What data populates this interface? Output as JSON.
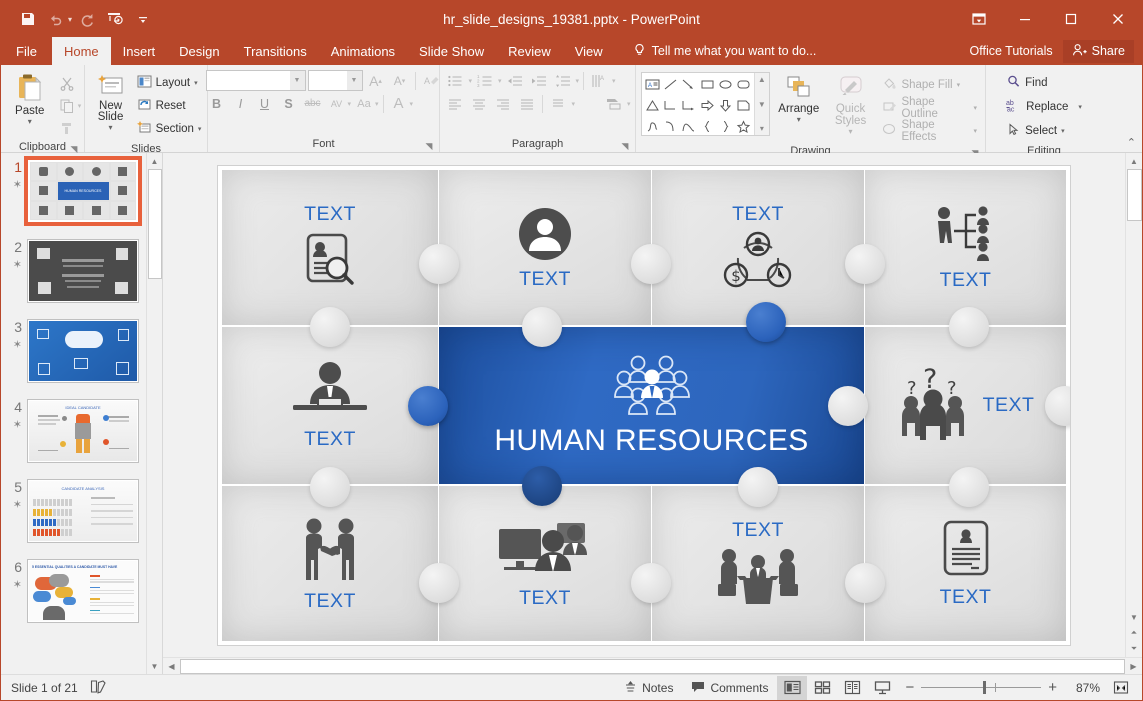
{
  "window": {
    "title": "hr_slide_designs_19381.pptx - PowerPoint",
    "quick_access": [
      {
        "name": "save-icon",
        "label": "Save"
      },
      {
        "name": "undo-icon",
        "label": "Undo"
      },
      {
        "name": "redo-icon",
        "label": "Redo"
      },
      {
        "name": "start-slideshow-icon",
        "label": "Start From Beginning"
      },
      {
        "name": "customize-qat-icon",
        "label": "Customize Quick Access Toolbar"
      }
    ],
    "controls": [
      {
        "name": "ribbon-display-options-icon",
        "label": "Ribbon Display Options"
      },
      {
        "name": "minimize-icon",
        "label": "Minimize"
      },
      {
        "name": "restore-icon",
        "label": "Restore Down"
      },
      {
        "name": "close-icon",
        "label": "Close"
      }
    ],
    "accent_color": "#b7472a"
  },
  "tabs": [
    {
      "label": "File",
      "active": false
    },
    {
      "label": "Home",
      "active": true
    },
    {
      "label": "Insert",
      "active": false
    },
    {
      "label": "Design",
      "active": false
    },
    {
      "label": "Transitions",
      "active": false
    },
    {
      "label": "Animations",
      "active": false
    },
    {
      "label": "Slide Show",
      "active": false
    },
    {
      "label": "Review",
      "active": false
    },
    {
      "label": "View",
      "active": false
    }
  ],
  "tellme": {
    "placeholder": "Tell me what you want to do...",
    "icon": "lightbulb-icon"
  },
  "account": {
    "name": "Office Tutorials",
    "share_label": "Share",
    "share_icon": "person-add-icon"
  },
  "ribbon": {
    "groups": [
      {
        "label": "Clipboard",
        "items": [
          {
            "label": "Paste",
            "name": "paste-button",
            "icon": "clipboard-icon"
          },
          {
            "label": "Cut",
            "name": "cut-button",
            "icon": "scissors-icon"
          },
          {
            "label": "Copy",
            "name": "copy-button",
            "icon": "copy-icon"
          },
          {
            "label": "Format Painter",
            "name": "format-painter-button",
            "icon": "paintbrush-icon"
          }
        ]
      },
      {
        "label": "Slides",
        "items": [
          {
            "label": "New Slide",
            "name": "new-slide-button",
            "icon": "new-slide-icon"
          },
          {
            "label": "Layout",
            "name": "layout-button",
            "icon": "layout-icon"
          },
          {
            "label": "Reset",
            "name": "reset-button",
            "icon": "reset-icon"
          },
          {
            "label": "Section",
            "name": "section-button",
            "icon": "section-icon"
          }
        ]
      },
      {
        "label": "Font",
        "font_name": "",
        "font_size": "",
        "buttons": [
          {
            "label": "B",
            "name": "bold-button"
          },
          {
            "label": "I",
            "name": "italic-button"
          },
          {
            "label": "U",
            "name": "underline-button"
          },
          {
            "label": "S",
            "name": "shadow-button"
          },
          {
            "label": "abc",
            "name": "strikethrough-button"
          },
          {
            "label": "AV",
            "name": "character-spacing-button"
          },
          {
            "label": "Aa",
            "name": "change-case-button"
          },
          {
            "label": "A",
            "name": "font-color-button"
          }
        ],
        "grow_label": "A",
        "shrink_label": "A",
        "clear_label": "Clear All Formatting"
      },
      {
        "label": "Paragraph"
      },
      {
        "label": "Drawing",
        "arrange_label": "Arrange",
        "quick_styles_label": "Quick Styles",
        "shape_fill_label": "Shape Fill",
        "shape_outline_label": "Shape Outline",
        "shape_effects_label": "Shape Effects"
      },
      {
        "label": "Editing",
        "items": [
          {
            "label": "Find",
            "name": "find-button",
            "icon": "magnifier-icon"
          },
          {
            "label": "Replace",
            "name": "replace-button",
            "icon": "replace-icon"
          },
          {
            "label": "Select",
            "name": "select-button",
            "icon": "cursor-icon"
          }
        ]
      }
    ],
    "collapse_label": "Collapse the Ribbon"
  },
  "thumbnails": [
    {
      "number": "1",
      "selected": true,
      "kind": "puzzle"
    },
    {
      "number": "2",
      "selected": false,
      "kind": "dark-diagram"
    },
    {
      "number": "3",
      "selected": false,
      "kind": "blue-cloud"
    },
    {
      "number": "4",
      "selected": false,
      "kind": "ideal-candidate",
      "title": "IDEAL CANDIDATE"
    },
    {
      "number": "5",
      "selected": false,
      "kind": "candidate-analysis",
      "title": "CANDIDATE ANALYSIS"
    },
    {
      "number": "6",
      "selected": false,
      "kind": "essential-qualities",
      "title": "5 ESSENTIAL QUALITIES A CANDIDATE MUST HAVE"
    }
  ],
  "slide": {
    "center_title": "HUMAN RESOURCES",
    "center_icon": "group-of-people-icon",
    "pieces": [
      {
        "pos": "r1c1",
        "label": "TEXT",
        "label_pos": "top",
        "icon": "resume-search-icon"
      },
      {
        "pos": "r1c2",
        "label": "TEXT",
        "label_pos": "bottom",
        "icon": "user-circle-icon"
      },
      {
        "pos": "r1c3",
        "label": "TEXT",
        "label_pos": "top",
        "icon": "time-money-people-cycle-icon"
      },
      {
        "pos": "r1c4",
        "label": "TEXT",
        "label_pos": "bottom",
        "icon": "org-chart-icon"
      },
      {
        "pos": "r2c1",
        "label": "TEXT",
        "label_pos": "bottom",
        "icon": "businessman-desk-icon"
      },
      {
        "pos": "r2c4",
        "label": "TEXT",
        "label_pos": "right",
        "icon": "people-question-marks-icon"
      },
      {
        "pos": "r3c1",
        "label": "TEXT",
        "label_pos": "bottom",
        "icon": "handshake-icon"
      },
      {
        "pos": "r3c2",
        "label": "TEXT",
        "label_pos": "bottom",
        "icon": "training-presentation-icon"
      },
      {
        "pos": "r3c3",
        "label": "TEXT",
        "label_pos": "top",
        "icon": "meeting-table-icon"
      },
      {
        "pos": "r3c4",
        "label": "TEXT",
        "label_pos": "bottom",
        "icon": "document-profile-icon"
      }
    ],
    "colors": {
      "accent_blue": "#2a6ac4",
      "piece_gray": "#e3e3e3",
      "text_blue": "#2a6ac4"
    }
  },
  "statusbar": {
    "slide_counter": "Slide 1 of 21",
    "notes_label": "Notes",
    "comments_label": "Comments",
    "zoom_percent": "87%",
    "icons": {
      "accessibility": "notes-page-icon",
      "notes": "notes-icon",
      "comments": "comment-icon",
      "normal_view": "normal-view-icon",
      "slide_sorter": "slide-sorter-icon",
      "reading_view": "reading-view-icon",
      "slideshow": "slideshow-icon",
      "zoom_out": "minus-icon",
      "zoom_in": "plus-icon",
      "fit_slide": "fit-to-window-icon"
    }
  }
}
